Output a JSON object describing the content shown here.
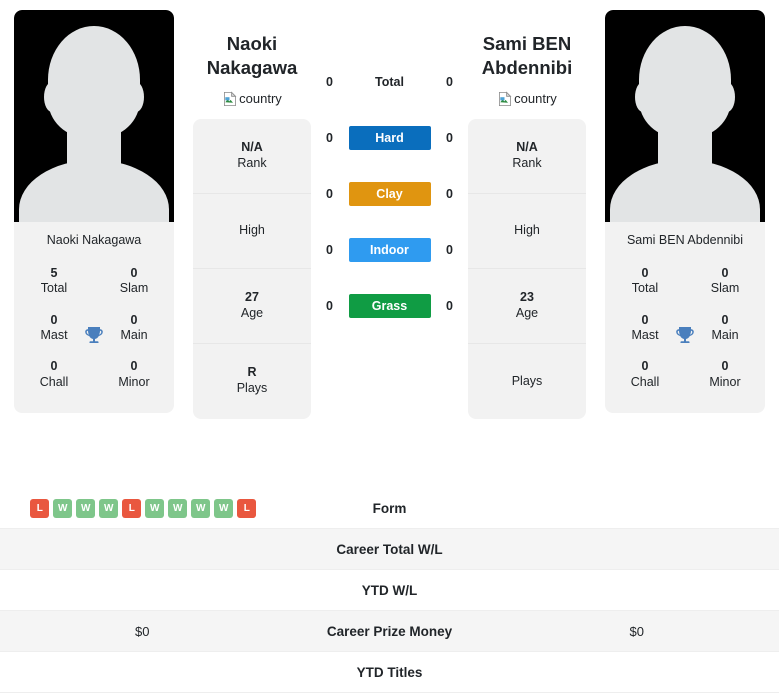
{
  "players": {
    "left": {
      "name_line1": "Naoki",
      "name_line2": "Nakagawa",
      "full_name": "Naoki Nakagawa",
      "country_alt": "country",
      "titles": [
        {
          "num": "5",
          "label": "Total"
        },
        {
          "num": "0",
          "label": "Slam"
        },
        {
          "num": "0",
          "label": "Mast"
        },
        {
          "num": "0",
          "label": "Main"
        },
        {
          "num": "0",
          "label": "Chall"
        },
        {
          "num": "0",
          "label": "Minor"
        }
      ],
      "info": [
        {
          "value": "N/A",
          "key": "Rank"
        },
        {
          "value": "",
          "key": "High"
        },
        {
          "value": "27",
          "key": "Age"
        },
        {
          "value": "R",
          "key": "Plays"
        }
      ]
    },
    "right": {
      "name_line1": "Sami BEN",
      "name_line2": "Abdennibi",
      "full_name": "Sami BEN Abdennibi",
      "country_alt": "country",
      "titles": [
        {
          "num": "0",
          "label": "Total"
        },
        {
          "num": "0",
          "label": "Slam"
        },
        {
          "num": "0",
          "label": "Mast"
        },
        {
          "num": "0",
          "label": "Main"
        },
        {
          "num": "0",
          "label": "Chall"
        },
        {
          "num": "0",
          "label": "Minor"
        }
      ],
      "info": [
        {
          "value": "N/A",
          "key": "Rank"
        },
        {
          "value": "",
          "key": "High"
        },
        {
          "value": "23",
          "key": "Age"
        },
        {
          "value": "",
          "key": "Plays"
        }
      ]
    }
  },
  "surfaces": [
    {
      "label": "Total",
      "left": "0",
      "right": "0",
      "color": "transparent"
    },
    {
      "label": "Hard",
      "left": "0",
      "right": "0",
      "color": "#0a6ebd"
    },
    {
      "label": "Clay",
      "left": "0",
      "right": "0",
      "color": "#e09510"
    },
    {
      "label": "Indoor",
      "left": "0",
      "right": "0",
      "color": "#2f9bf0"
    },
    {
      "label": "Grass",
      "left": "0",
      "right": "0",
      "color": "#109c44"
    }
  ],
  "stats": [
    {
      "label": "Form",
      "left_form": [
        "L",
        "W",
        "W",
        "W",
        "L",
        "W",
        "W",
        "W",
        "W",
        "L"
      ],
      "right_form": [],
      "left": "",
      "right": "",
      "alt": false
    },
    {
      "label": "Career Total W/L",
      "left": "",
      "right": "",
      "alt": true
    },
    {
      "label": "YTD W/L",
      "left": "",
      "right": "",
      "alt": false
    },
    {
      "label": "Career Prize Money",
      "left": "$0",
      "right": "$0",
      "alt": true
    },
    {
      "label": "YTD Titles",
      "left": "",
      "right": "",
      "alt": false
    }
  ],
  "colors": {
    "win": "#7ec68a",
    "loss": "#e9573f",
    "trophy": "#4a7fbd",
    "card_bg": "#f2f2f2",
    "row_alt_bg": "#f5f5f5"
  }
}
